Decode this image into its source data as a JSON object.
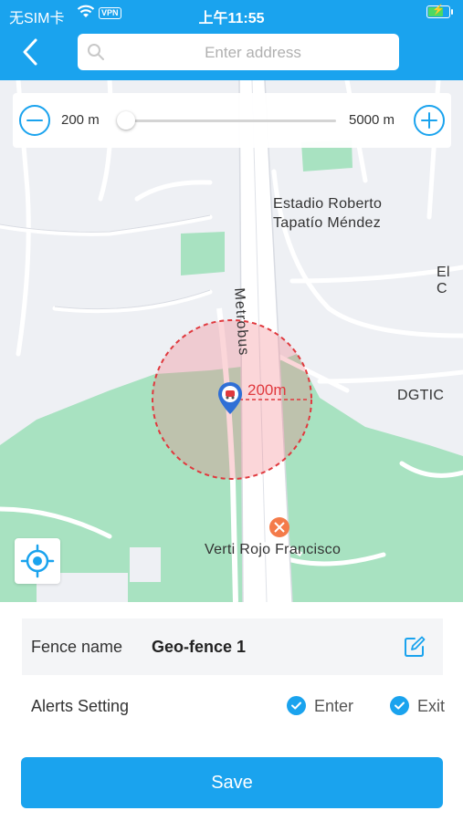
{
  "status_bar": {
    "carrier": "无SIM卡",
    "vpn": "VPN",
    "time": "上午11:55",
    "battery_level": 0.75,
    "battery_color": "#4cd964"
  },
  "header": {
    "background": "#1aa3ee",
    "back_icon": "chevron-left-icon",
    "search": {
      "placeholder": "Enter address",
      "value": "",
      "icon": "search-icon"
    }
  },
  "map": {
    "zoom": {
      "min_label": "200 m",
      "max_label": "5000 m",
      "min_value": 200,
      "max_value": 5000,
      "current_value": 200,
      "zoom_out_icon": "minus-circle-icon",
      "zoom_in_icon": "plus-circle-icon"
    },
    "places": {
      "stadium_line1": "Estadio Roberto",
      "stadium_line2": "Tapatío Méndez",
      "el_c": "El C",
      "dgtic": "DGTIC",
      "metrobus": "Metrobus",
      "verti": "Verti Rojo Francisco"
    },
    "fence_radius_label": "200m",
    "fence_color": "#e0393e",
    "locate_icon": "crosshair-icon",
    "pin_icon": "vehicle-pin-icon"
  },
  "form": {
    "fence_name_label": "Fence name",
    "fence_name_value": "Geo-fence 1",
    "edit_icon": "edit-icon",
    "alerts_label": "Alerts Setting",
    "alerts": [
      {
        "label": "Enter",
        "checked": true
      },
      {
        "label": "Exit",
        "checked": true
      }
    ],
    "save_label": "Save",
    "accent": "#1aa3ee"
  }
}
